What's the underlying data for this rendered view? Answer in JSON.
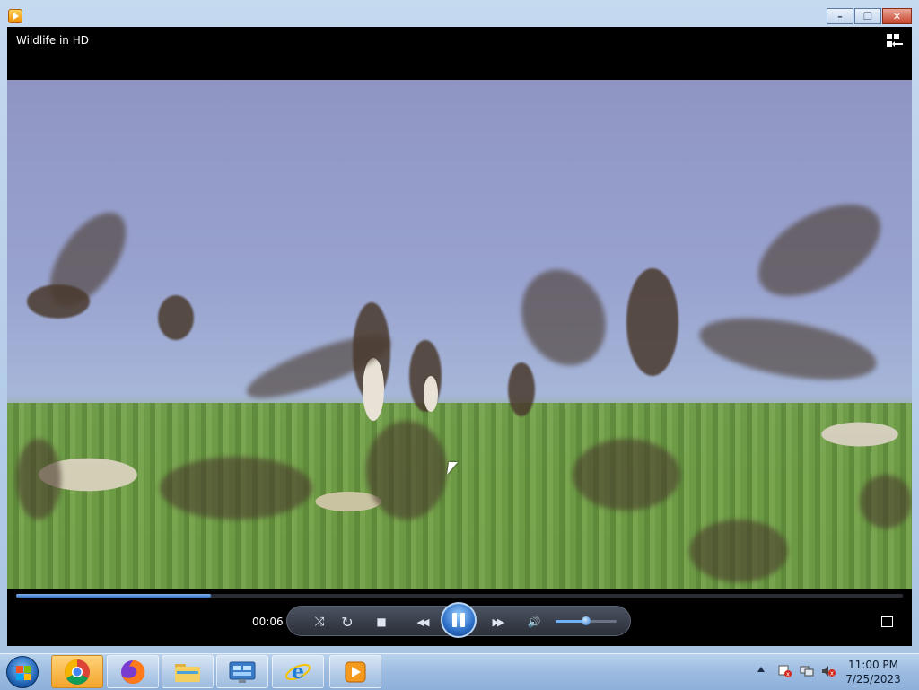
{
  "window": {
    "caption_buttons": {
      "minimize": "–",
      "maximize": "❐",
      "close": "✕"
    }
  },
  "player": {
    "media_title": "Wildlife in HD",
    "elapsed_time": "00:06",
    "progress_fraction": 0.22,
    "volume_fraction": 0.5,
    "controls": {
      "shuffle": "⤨",
      "repeat": "↻",
      "stop": "■",
      "previous": "◀◀",
      "next": "▶▶",
      "mute": "🔊"
    }
  },
  "taskbar": {
    "pinned": [
      {
        "name": "chrome",
        "icon": "chrome-icon"
      },
      {
        "name": "firefox",
        "icon": "firefox-icon"
      },
      {
        "name": "file-explorer",
        "icon": "folder-icon"
      },
      {
        "name": "control-panel",
        "icon": "control-panel-icon"
      },
      {
        "name": "internet-explorer",
        "icon": "ie-icon"
      },
      {
        "name": "windows-media-player",
        "icon": "media-player-icon"
      }
    ],
    "clock": {
      "time": "11:00 PM",
      "date": "7/25/2023"
    }
  },
  "colors": {
    "accent": "#3b73c4",
    "taskbar": "#9cbbe0",
    "close": "#c8442b"
  }
}
